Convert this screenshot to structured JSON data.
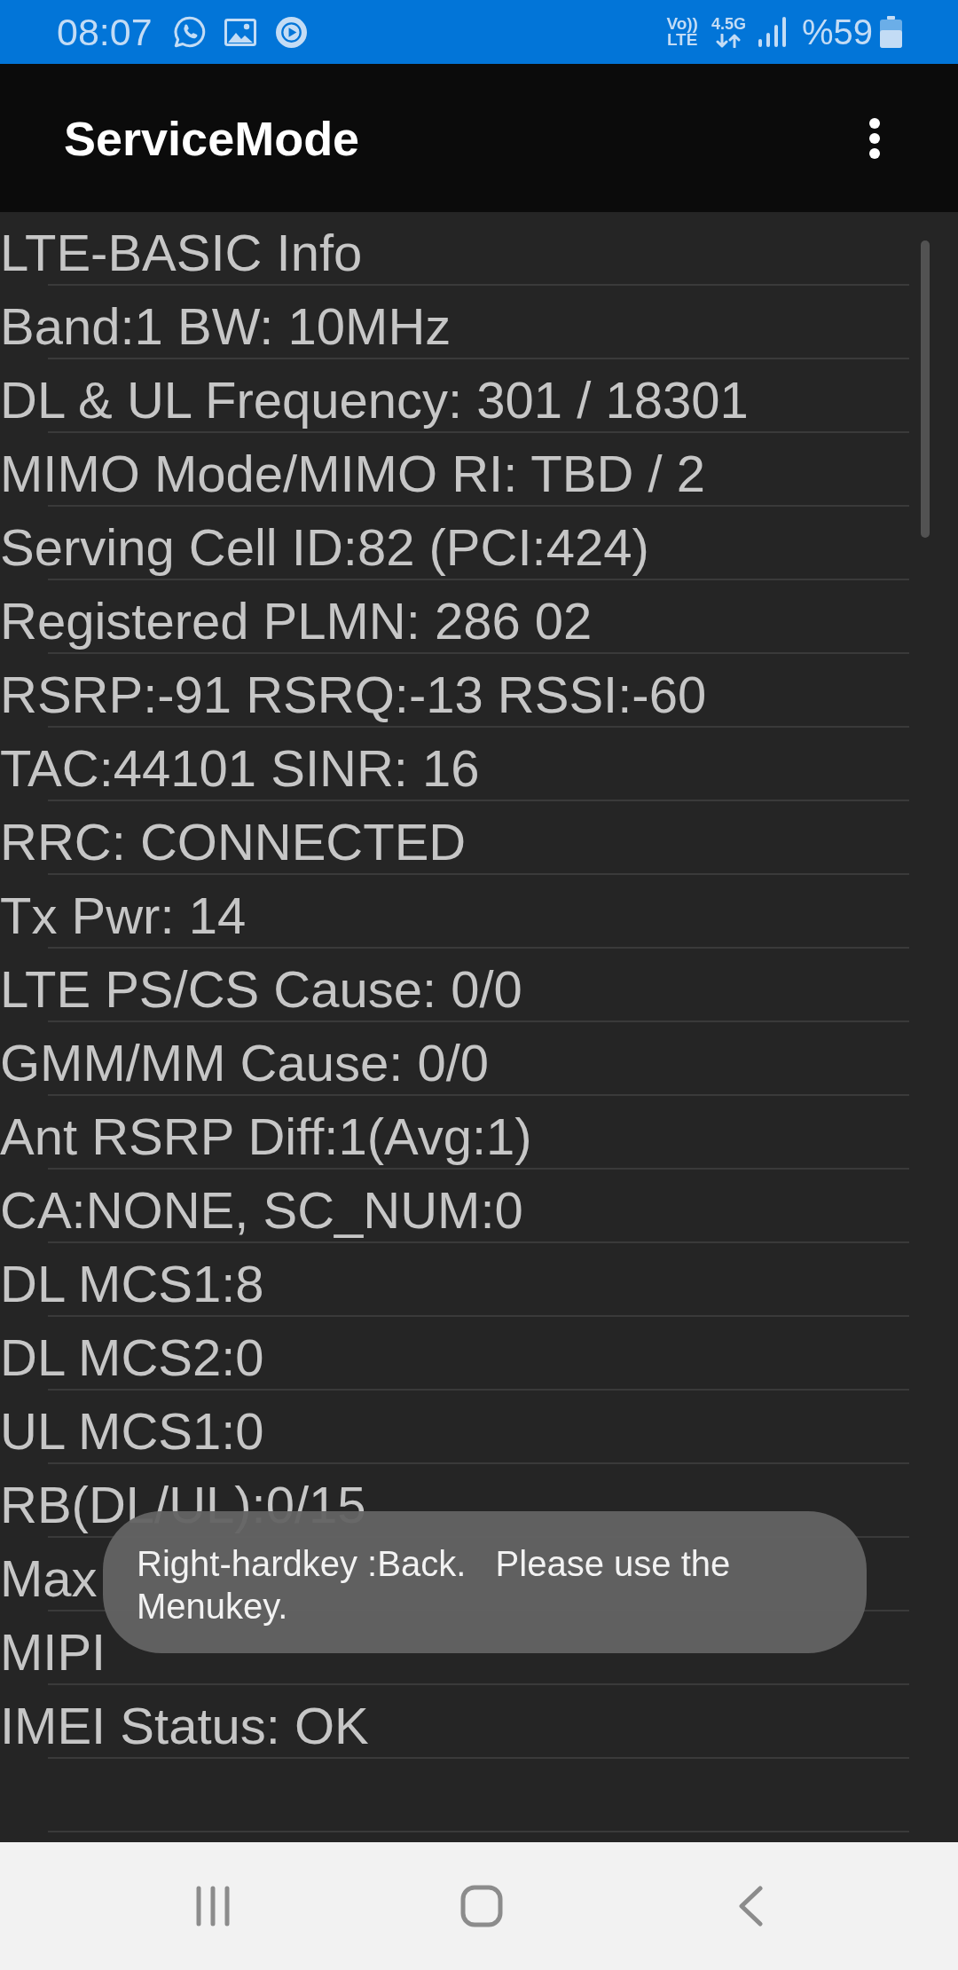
{
  "status_bar": {
    "time": "08:07",
    "volte": {
      "top": "Vo))",
      "bottom": "LTE"
    },
    "network_type": "4.5G",
    "battery_percent": "%59"
  },
  "app_bar": {
    "title": "ServiceMode"
  },
  "info_rows": [
    "LTE-BASIC Info",
    "Band:1 BW: 10MHz",
    "DL & UL Frequency: 301 / 18301",
    "MIMO Mode/MIMO RI: TBD / 2",
    "Serving Cell ID:82 (PCI:424)",
    "Registered PLMN: 286 02",
    "RSRP:-91 RSRQ:-13 RSSI:-60",
    "TAC:44101 SINR: 16",
    "RRC: CONNECTED",
    "Tx Pwr: 14",
    "LTE PS/CS Cause: 0/0",
    "GMM/MM Cause: 0/0",
    "Ant RSRP Diff:1(Avg:1)",
    "CA:NONE, SC_NUM:0",
    "DL MCS1:8",
    "DL MCS2:0",
    "UL MCS1:0",
    "RB(DL/UL):0/15",
    "Max",
    "MIPI",
    "IMEI Status: OK"
  ],
  "toast": {
    "text": "Right-hardkey :Back.   Please use the Menukey."
  }
}
